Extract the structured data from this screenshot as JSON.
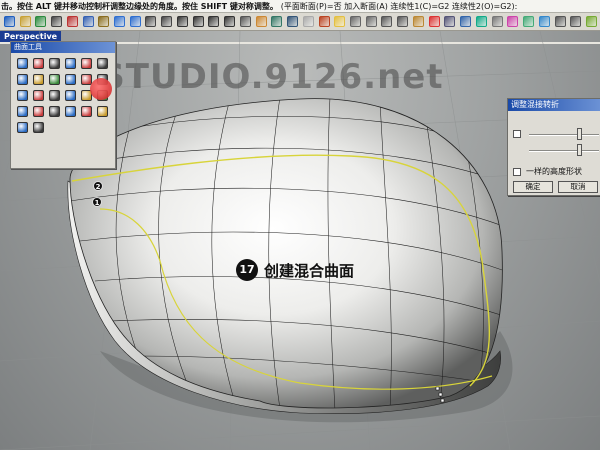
{
  "command_bar": {
    "prompt": "击。按住 ALT 键并移动控制杆调整边缘处的角度。按住 SHIFT 键对称调整。",
    "options": "(平面断面(P)=否  加入断面(A)  连续性1(C)=G2  连续性2(O)=G2):"
  },
  "toolbar": {
    "icons": [
      "new-icon",
      "open-icon",
      "save-icon",
      "print-icon",
      "cut-icon",
      "copy-icon",
      "paste-icon",
      "undo-icon",
      "redo-icon",
      "pan-icon",
      "rotate-icon",
      "zoom-icon",
      "zoom-window-icon",
      "zoom-extents-icon",
      "zoom-selected-icon",
      "undo-view-icon",
      "layer-icon",
      "properties-icon",
      "wireframe-icon",
      "shade-icon",
      "render-icon",
      "light-icon",
      "grid-icon",
      "snap-icon",
      "ortho-icon",
      "planar-icon",
      "osnap-icon",
      "record-icon",
      "history-icon",
      "help-icon",
      "render-preview-icon",
      "options-icon",
      "material-icon",
      "texture-icon",
      "environment-icon",
      "camera-icon",
      "section-icon",
      "analysis-icon"
    ],
    "colors": [
      "#1f5fbf",
      "#c8a236",
      "#2b8a3e",
      "#444",
      "#b33",
      "#3561b3",
      "#8a6d1f",
      "#2f6fd0",
      "#2f6fd0",
      "#444",
      "#444",
      "#333",
      "#333",
      "#333",
      "#333",
      "#555",
      "#c83",
      "#376",
      "#357",
      "#aaa",
      "#b42",
      "#e4c040",
      "#666",
      "#666",
      "#555",
      "#555",
      "#b83",
      "#d33",
      "#557",
      "#36a",
      "#1a8",
      "#777",
      "#c4a",
      "#4a7",
      "#38c",
      "#555",
      "#555",
      "#7a3"
    ]
  },
  "viewport": {
    "title": "Perspective"
  },
  "watermark": "LISTUDIO.9126.net",
  "curve_toolbar": {
    "title": "曲面工具",
    "icons": [
      "blend-surface-icon",
      "sweep1-icon",
      "sweep2-icon",
      "loft-icon",
      "revolve-icon",
      "network-icon",
      "rail-revolve-icon",
      "extrude-icon",
      "patch-icon",
      "edge-surface-icon",
      "plane-icon",
      "corner-surface-icon",
      "drape-icon",
      "fillet-surface-icon",
      "offset-surface-icon",
      "extend-surface-icon",
      "match-surface-icon",
      "rebuild-icon",
      "trim-icon",
      "split-icon",
      "join-icon",
      "explode-icon",
      "merge-icon",
      "close-icon",
      "unroll-icon",
      "flow-icon"
    ],
    "colors": [
      "#2b6cc4",
      "#c83c3c",
      "#3a3a3a",
      "#2b6cc4",
      "#c83c3c",
      "#3a3a3a",
      "#2b6cc4",
      "#c89b2c",
      "#3a8a3a",
      "#2b6cc4",
      "#c83c3c",
      "#3a3a3a",
      "#2b6cc4",
      "#c83c3c",
      "#3a3a3a",
      "#2b6cc4",
      "#c89b2c",
      "#3a8a3a",
      "#2b6cc4",
      "#c83c3c",
      "#3a3a3a",
      "#2b6cc4",
      "#c83c3c",
      "#c89b2c",
      "#2b6cc4",
      "#3a3a3a"
    ]
  },
  "dialog": {
    "title": "调整混接转折",
    "checkbox_label": "一样的高度形状",
    "ok_label": "确定",
    "cancel_label": "取消"
  },
  "markers": {
    "m1": "1",
    "m2": "2"
  },
  "step": {
    "number": "17",
    "label": "创建混合曲面"
  }
}
